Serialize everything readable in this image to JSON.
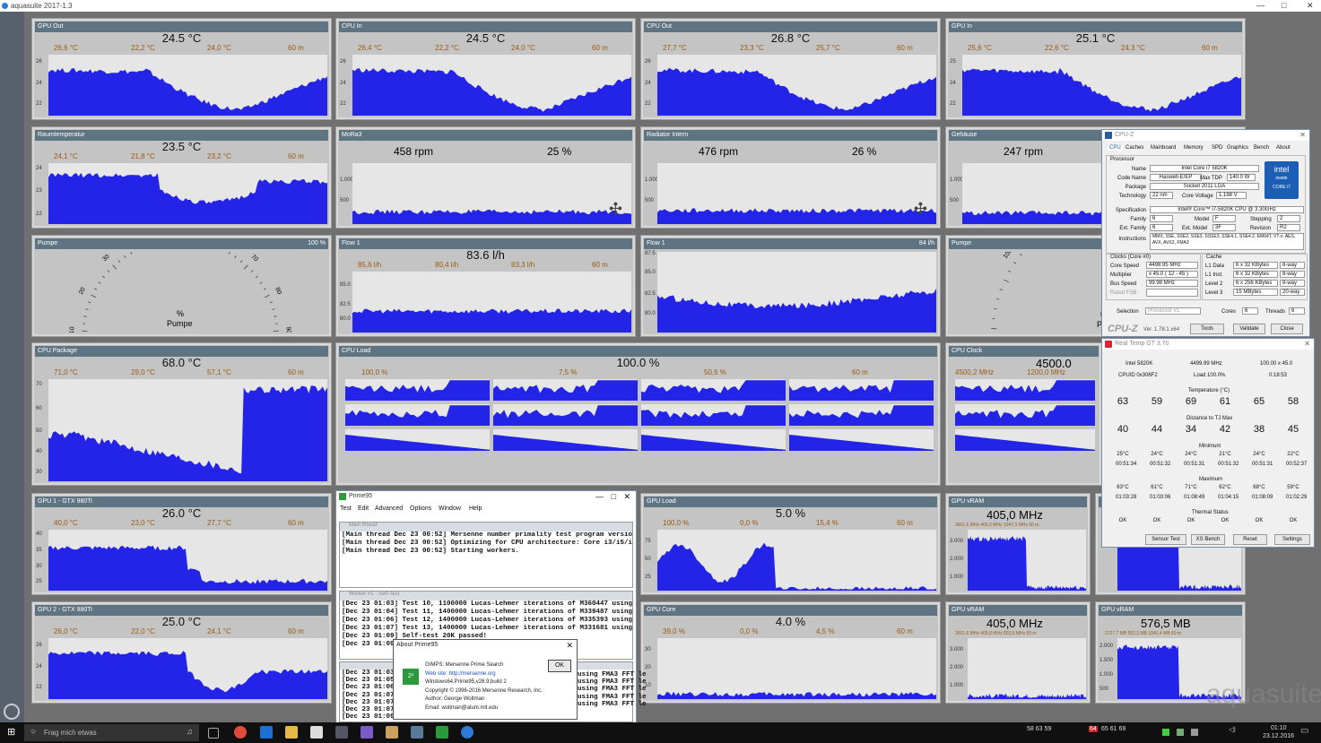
{
  "window": {
    "title": "aquasuite 2017-1.3"
  },
  "brand": "aquacomputer",
  "watermark": "aquasuite",
  "panels": {
    "gpu_out": {
      "title": "GPU Out",
      "value": "24.5 °C",
      "max": "26,6 °C",
      "min": "22,2 °C",
      "avg": "24,0 °C",
      "span": "60 m",
      "yticks": [
        "26",
        "24",
        "22"
      ]
    },
    "cpu_in": {
      "title": "CPU In",
      "value": "24.5 °C",
      "max": "26,4 °C",
      "min": "22,2 °C",
      "avg": "24,0 °C",
      "span": "60 m",
      "yticks": [
        "26",
        "24",
        "22"
      ]
    },
    "cpu_out": {
      "title": "CPU Out",
      "value": "26.8 °C",
      "max": "27,7 °C",
      "min": "23,3 °C",
      "avg": "25,7 °C",
      "span": "60 m",
      "yticks": [
        "26",
        "24",
        "22"
      ]
    },
    "gpu_in": {
      "title": "GPU In",
      "value": "25.1 °C",
      "max": "25,6 °C",
      "min": "22,6 °C",
      "avg": "24,3 °C",
      "span": "60 m",
      "yticks": [
        "25",
        "24",
        "22"
      ]
    },
    "raum": {
      "title": "Raumtemperatur",
      "value": "23.5 °C",
      "max": "24,1 °C",
      "min": "21,8 °C",
      "avg": "23,2 °C",
      "span": "60 m",
      "yticks": [
        "24",
        "23",
        "22"
      ]
    },
    "mora": {
      "title": "MoRa3",
      "rpm": "458 rpm",
      "pct": "25 %",
      "yticks": [
        "1.000",
        "500"
      ]
    },
    "radiator": {
      "title": "Radiator Intern",
      "rpm": "476 rpm",
      "pct": "26 %",
      "yticks": [
        "1.000",
        "500"
      ]
    },
    "gehaeuse": {
      "title": "Gehäuse",
      "rpm": "247 rpm",
      "yticks": [
        "1.000",
        "500"
      ]
    },
    "pumpe": {
      "title": "Pumpe",
      "right": "100 %",
      "unit": "%",
      "label": "Pumpe",
      "ticks": [
        "0",
        "10",
        "20",
        "30",
        "40",
        "50",
        "60",
        "70",
        "80",
        "90",
        "100"
      ]
    },
    "flow1": {
      "title": "Flow 1",
      "value": "83.6 l/h",
      "max": "85,6 l/h",
      "min": "80,4 l/h",
      "avg": "83,3 l/h",
      "span": "60 m",
      "yticks": [
        "85.0",
        "82.5",
        "80.0"
      ]
    },
    "flow1b": {
      "title": "Flow 1",
      "right": "84 l/h",
      "yticks": [
        "87.5",
        "85.0",
        "82.5",
        "80.0"
      ]
    },
    "pumpe_rpm": {
      "title": "Pumpe",
      "unit": "rpm",
      "label": "Pump",
      "ticks": [
        "500",
        "1000",
        "1500",
        "2000",
        "2500"
      ]
    },
    "cpu_package": {
      "title": "CPU Package",
      "value": "68.0 °C",
      "max": "71,0 °C",
      "min": "29,0 °C",
      "avg": "57,1 °C",
      "span": "60 m",
      "yticks": [
        "70",
        "60",
        "50",
        "40",
        "30"
      ]
    },
    "cpu_load": {
      "title": "CPU Load",
      "value": "100.0 %",
      "max": "100,0 %",
      "min": "7,5 %",
      "avg": "50,6 %",
      "span": "60 m"
    },
    "cpu_clock": {
      "title": "CPU Clock",
      "value": "4500.0",
      "max": "4500,2 MHz",
      "min": "1200,0 MHz"
    },
    "gpu1": {
      "title": "GPU 1 - GTX 980Ti",
      "value": "26.0 °C",
      "max": "40,0 °C",
      "min": "23,0 °C",
      "avg": "27,7 °C",
      "span": "60 m",
      "yticks": [
        "40",
        "35",
        "30",
        "25"
      ]
    },
    "gpu2": {
      "title": "GPU 2 - GTX 980Ti",
      "value": "25.0 °C",
      "max": "26,0 °C",
      "min": "22,0 °C",
      "avg": "24,1 °C",
      "span": "60 m",
      "yticks": [
        "26",
        "24",
        "22"
      ]
    },
    "gpu_load": {
      "title": "GPU Load",
      "value": "5.0 %",
      "max": "100,0 %",
      "min": "0,0 %",
      "avg": "15,4 %",
      "span": "60 m",
      "yticks": [
        "75",
        "50",
        "25"
      ]
    },
    "gpu_core": {
      "title": "GPU Core",
      "value": "4.0 %",
      "max": "39,0 %",
      "min": "0,0 %",
      "avg": "4,5 %",
      "span": "60 m",
      "yticks": [
        "30",
        "20",
        "10"
      ]
    },
    "gpu_vram1": {
      "title": "GPU vRAM",
      "value": "405,0 MHz",
      "sub": "3601,6 MHz   405,0 MHz   1947,3 MHz   60 m",
      "yticks": [
        "3.000",
        "2.000",
        "1.000"
      ]
    },
    "gpu_vram2": {
      "title": "GPU vRAM",
      "value": "405,0 MHz",
      "sub": "3601,6 MHz   405,0 MHz   802,6 MHz   60 m",
      "yticks": [
        "3.000",
        "2.000",
        "1.000"
      ]
    },
    "gpu_vram3": {
      "title": "GPU vRAM",
      "value": "576,5 MB",
      "sub": "2727,7 MB   552,3 MB   1040,4 MB   60 m",
      "yticks": [
        "2.000",
        "1.500",
        "1.000",
        "500"
      ]
    }
  },
  "cpuz": {
    "title": "CPU-Z",
    "tabs": [
      "CPU",
      "Caches",
      "Mainboard",
      "Memory",
      "SPD",
      "Graphics",
      "Bench",
      "About"
    ],
    "processor_label": "Processor",
    "name_label": "Name",
    "name": "Intel Core i7 5820K",
    "codename_label": "Code Name",
    "codename": "Haswell-E/EP",
    "tdp_label": "Max TDP",
    "tdp": "140.0 W",
    "package_label": "Package",
    "package": "Socket 2011 LGA",
    "technology_label": "Technology",
    "technology": "22 nm",
    "voltage_label": "Core Voltage",
    "voltage": "1.198 V",
    "spec_label": "Specification",
    "spec": "Intel® Core™ i7-5820K CPU @ 3.30GHz",
    "family_label": "Family",
    "family": "6",
    "model_label": "Model",
    "model": "F",
    "stepping_label": "Stepping",
    "stepping": "2",
    "extfamily_label": "Ext. Family",
    "extfamily": "6",
    "extmodel_label": "Ext. Model",
    "extmodel": "3F",
    "revision_label": "Revision",
    "revision": "R2",
    "instr_label": "Instructions",
    "instr": "MMX, SSE, SSE2, SSE3, SSSE3, SSE4.1, SSE4.2, EM64T, VT-x, AES, AVX, AVX2, FMA3",
    "clocks_label": "Clocks (Core #0)",
    "corespeed_label": "Core Speed",
    "corespeed": "4498.95 MHz",
    "multiplier_label": "Multiplier",
    "multiplier": "x 45.0 ( 12 - 45 )",
    "busspeed_label": "Bus Speed",
    "busspeed": "99.98 MHz",
    "ratedfsb_label": "Rated FSB",
    "cache_label": "Cache",
    "l1d_label": "L1 Data",
    "l1d": "6 x 32 KBytes",
    "l1d_way": "8-way",
    "l1i_label": "L1 Inst.",
    "l1i": "6 x 32 KBytes",
    "l1i_way": "8-way",
    "l2_label": "Level 2",
    "l2": "6 x 256 KBytes",
    "l2_way": "8-way",
    "l3_label": "Level 3",
    "l3": "15 MBytes",
    "l3_way": "20-way",
    "selection_label": "Selection",
    "selection": "Processor #1",
    "cores_label": "Cores",
    "cores": "6",
    "threads_label": "Threads",
    "threads": "6",
    "brand": "CPU-Z",
    "version": "Ver. 1.78.1.x64",
    "tools": "Tools",
    "validate": "Validate",
    "close": "Close",
    "intel_line1": "intel",
    "intel_line2": "inside",
    "intel_line3": "CORE i7"
  },
  "realtemp": {
    "title": "Real Temp GT 3.70",
    "cpu": "Intel 5820K",
    "mhz": "4499.99 MHz",
    "mult": "100.00 x 45.0",
    "cpuid": "CPUID  0x306F2",
    "load": "Load 100.0%",
    "time": "0:18:53",
    "temp_label": "Temperature (°C)",
    "temps": [
      "63",
      "59",
      "69",
      "61",
      "65",
      "58"
    ],
    "dist_label": "Distance to TJ Max",
    "dists": [
      "40",
      "44",
      "34",
      "42",
      "38",
      "45"
    ],
    "min_label": "Minimum",
    "mins": [
      "25°C",
      "24°C",
      "24°C",
      "21°C",
      "24°C",
      "22°C"
    ],
    "mintimes": [
      "00:51:34",
      "00:51:32",
      "00:51:31",
      "00:51:32",
      "00:51:31",
      "00:52:37"
    ],
    "max_label": "Maximum",
    "maxs": [
      "63°C",
      "61°C",
      "71°C",
      "62°C",
      "68°C",
      "59°C"
    ],
    "maxtimes": [
      "01:03:28",
      "01:03:06",
      "01:08:49",
      "01:04:15",
      "01:08:09",
      "01:02:29"
    ],
    "status_label": "Thermal Status",
    "status": [
      "OK",
      "OK",
      "OK",
      "OK",
      "OK",
      "OK"
    ],
    "buttons": [
      "Sensor Test",
      "XS Bench",
      "Reset",
      "Settings"
    ]
  },
  "prime": {
    "title": "Prime95",
    "menu": [
      "Test",
      "Edit",
      "Advanced",
      "Options",
      "Window",
      "Help"
    ],
    "main_title": "Main thread",
    "main_lines": [
      "[Main thread Dec 23 00:52] Mersenne number primality test program version 28.9",
      "[Main thread Dec 23 00:52] Optimizing for CPU architecture: Core i3/i5/i7, L2 cache size:",
      "[Main thread Dec 23 00:52] Starting workers."
    ],
    "worker_title": "Worker #1 - Self-Test",
    "worker_lines": [
      "[Dec 23 01:03] Test 10, 1100000 Lucas-Lehmer iterations of M360447 using FMA3 FFT le",
      "[Dec 23 01:04] Test 11, 1400000 Lucas-Lehmer iterations of M339487 using FMA3 FFT le",
      "[Dec 23 01:06] Test 12, 1400000 Lucas-Lehmer iterations of M335393 using FMA3 FFT le",
      "[Dec 23 01:07] Test 13, 1400000 Lucas-Lehmer iterations of M331681 using FMA3 FFT le",
      "[Dec 23 01:09] Self-test 20K passed!",
      "[Dec 23 01:09]"
    ],
    "worker2_lines": [
      "[Dec 23 01:03]",
      "[Dec 23 01:05]",
      "[Dec 23 01:06]",
      "[Dec 23 01:07]",
      "[Dec 23 01:07]",
      "[Dec 23 01:07]",
      "[Dec 23 01:09]"
    ],
    "worker2_tails": [
      "using FMA3 FFT le",
      "using FMA3 FFT le",
      "using FMA3 FFT le",
      "using FMA3 FFT le",
      "using FMA3 FFT le"
    ]
  },
  "about": {
    "title": "About Prime95",
    "line1": "GIMPS: Mersenne Prime Search",
    "line2": "Web site: http://mersenne.org",
    "line3": "Windows64,Prime95,v28.9,build 2",
    "line4": "Copyright © 1996-2016 Mersenne Research, Inc.",
    "line5": "Author: George Woltman",
    "line6": "Email:  woltman@alum.mit.edu",
    "ok": "OK"
  },
  "taskbar": {
    "search": "Frag mich etwas",
    "tray_nums": "58  63  59",
    "tray_nums2": "65  61  69",
    "tray_red": "64",
    "time": "01:10",
    "date": "23.12.2016"
  },
  "colors": {
    "fill": "#2424e8",
    "panel": "#c4c4c4",
    "header": "#5f7482",
    "stat": "#9a5a10"
  }
}
